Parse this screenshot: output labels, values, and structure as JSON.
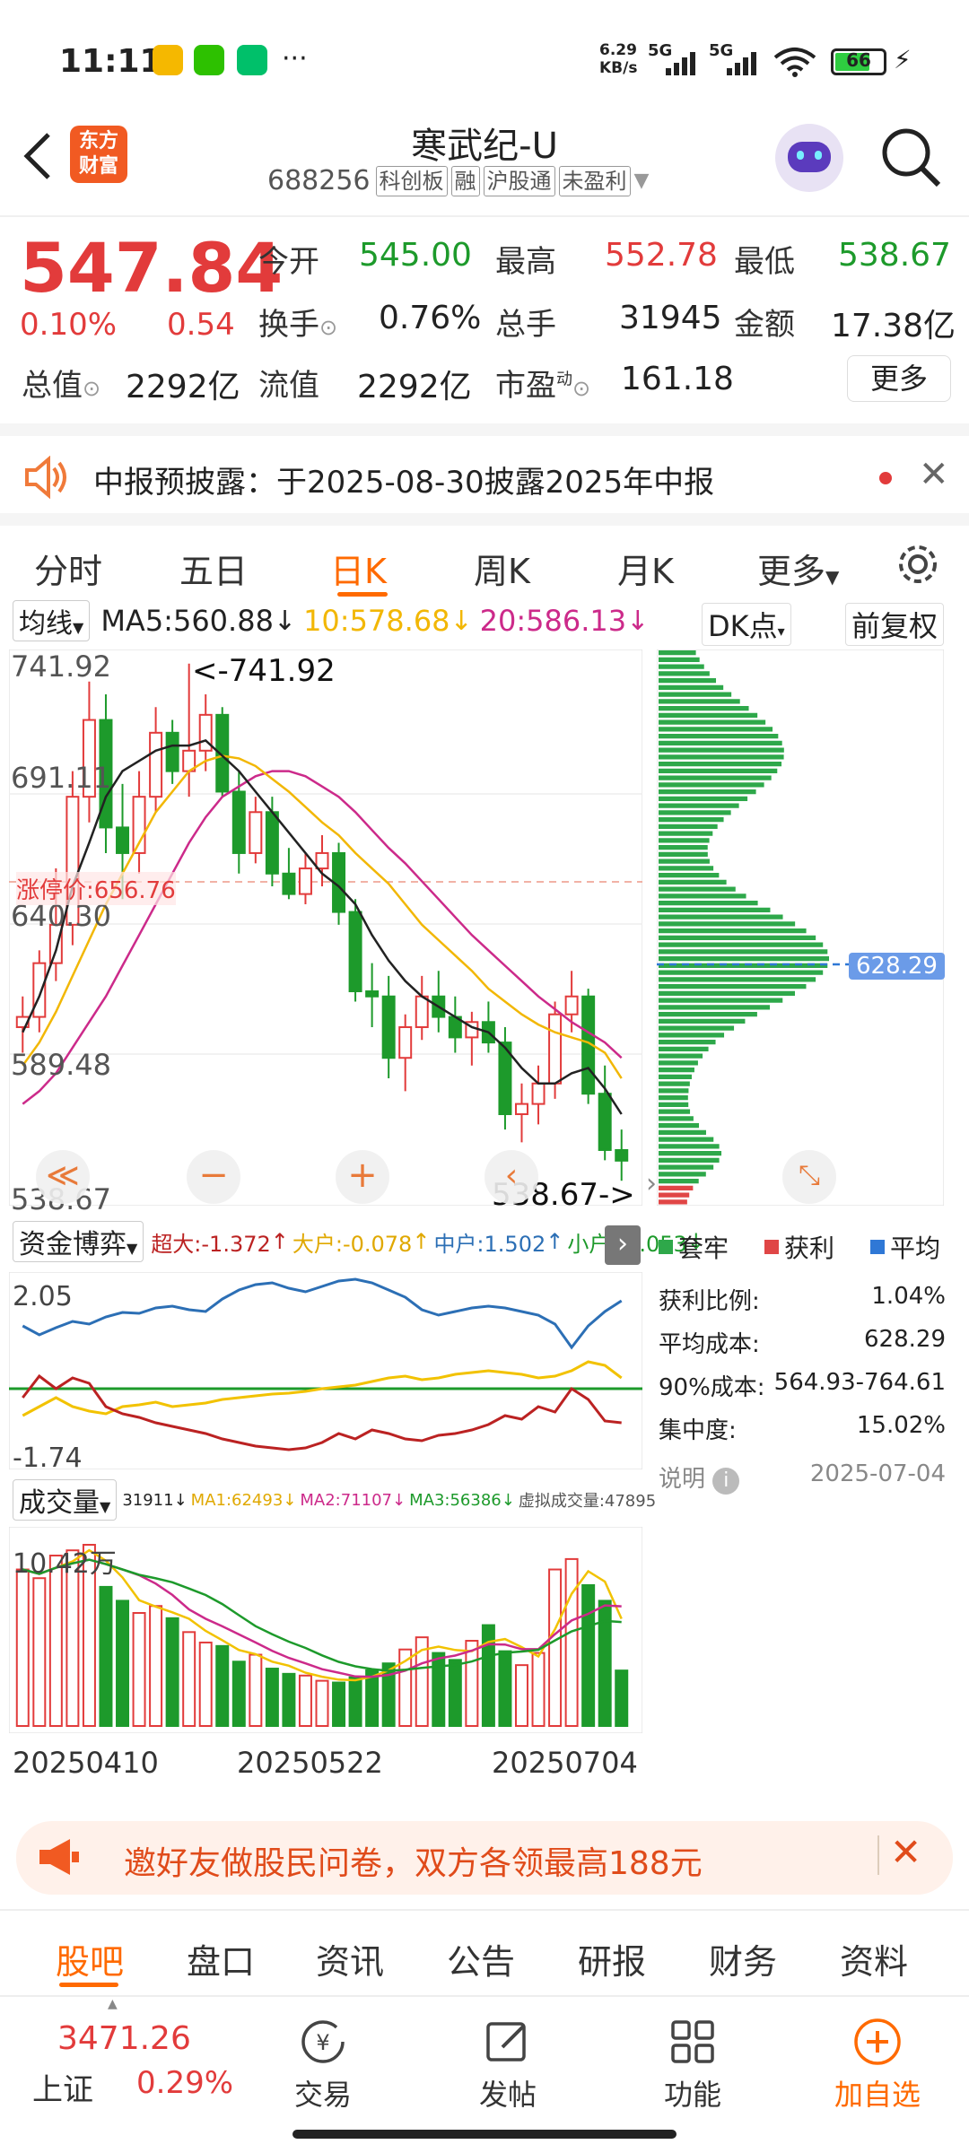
{
  "status": {
    "time": "11:11",
    "net_speed_top": "6.29",
    "net_speed_bottom": "KB/s",
    "signal1": "5G",
    "signal2": "5G",
    "battery": "66",
    "more": "···"
  },
  "header": {
    "back_icon": "chevron-left-icon",
    "logo_line1": "东方",
    "logo_line2": "财富",
    "title": "寒武纪-U",
    "code": "688256",
    "tags": [
      "科创板",
      "融",
      "沪股通",
      "未盈利"
    ],
    "search_icon": "search-icon"
  },
  "quote": {
    "price": "547.84",
    "change_pct": "0.10%",
    "change": "0.54",
    "open_label": "今开",
    "open": "545.00",
    "high_label": "最高",
    "high": "552.78",
    "low_label": "最低",
    "low": "538.67",
    "turnover_label": "换手",
    "turnover": "0.76%",
    "volume_label": "总手",
    "volume": "31945",
    "amount_label": "金额",
    "amount": "17.38亿",
    "mktcap_label": "总值",
    "mktcap": "2292亿",
    "float_label": "流值",
    "float_cap": "2292亿",
    "pe_label": "市盈",
    "pe_sup": "动",
    "pe": "161.18",
    "more_button": "更多"
  },
  "notice": {
    "text": "中报预披露：于2025-08-30披露2025年中报",
    "close_icon": "close-icon"
  },
  "chart_tabs": [
    "分时",
    "五日",
    "日K",
    "周K",
    "月K",
    "更多"
  ],
  "chart_tabs_active": 2,
  "ma_bar": {
    "selector": "均线",
    "ma5": "MA5:560.88",
    "ma10": "10:578.68",
    "ma20": "20:586.13",
    "dk_button": "DK点",
    "adjust_button": "前复权"
  },
  "kline": {
    "y_labels": [
      "741.92",
      "691.11",
      "640.30",
      "589.48",
      "538.67"
    ],
    "max_marker": "<-741.92",
    "min_marker": "538.67->",
    "limit_label": "涨停价:656.76",
    "cost_marker": "628.29"
  },
  "fund_bar": {
    "selector": "资金博弈",
    "chaoda": "超大:-1.372",
    "dahu": "大户:-0.078",
    "zhonghu": "中户:1.502",
    "xiaohu": "小户:-0.053",
    "y_top": "2.05",
    "y_bottom": "-1.74"
  },
  "chip_legend": [
    "套牢",
    "获利",
    "平均"
  ],
  "chip_stats": [
    {
      "label": "获利比例:",
      "value": "1.04%"
    },
    {
      "label": "平均成本:",
      "value": "628.29"
    },
    {
      "label": "90%成本:",
      "value": "564.93-764.61"
    },
    {
      "label": "集中度:",
      "value": "15.02%"
    }
  ],
  "chip_note": {
    "label": "说明",
    "date": "2025-07-04"
  },
  "volume_bar": {
    "selector": "成交量",
    "vol": "31911",
    "ma1": "MA1:62493",
    "ma2": "MA2:71107",
    "ma3": "MA3:56386",
    "virtual": "虚拟成交量:47895",
    "y_top": "10.42万"
  },
  "dates": [
    "20250410",
    "20250522",
    "20250704"
  ],
  "banner": {
    "text": "邀好友做股民问卷，双方各领最高188元"
  },
  "bottom_tabs": [
    "股吧",
    "盘口",
    "资讯",
    "公告",
    "研报",
    "财务",
    "资料"
  ],
  "nav": {
    "index_value": "3471.26",
    "index_name": "上证",
    "index_change": "0.29%",
    "items": [
      "交易",
      "发帖",
      "功能",
      "加自选"
    ]
  },
  "colors": {
    "up": "#e23b3b",
    "down": "#1d9a2b",
    "accent": "#ff6a00",
    "ma5": "#222222",
    "ma10": "#f2b705",
    "ma20": "#cc2a8a"
  },
  "chart_data": {
    "type": "candlestick",
    "ylim": [
      538.67,
      741.92
    ],
    "candles": [
      [
        600,
        612,
        590,
        604
      ],
      [
        604,
        630,
        598,
        625
      ],
      [
        625,
        662,
        618,
        640
      ],
      [
        640,
        700,
        632,
        690
      ],
      [
        690,
        735,
        680,
        720
      ],
      [
        720,
        730,
        668,
        678
      ],
      [
        678,
        695,
        650,
        668
      ],
      [
        668,
        700,
        660,
        690
      ],
      [
        690,
        725,
        684,
        715
      ],
      [
        715,
        720,
        695,
        700
      ],
      [
        700,
        742,
        690,
        708
      ],
      [
        708,
        730,
        700,
        722
      ],
      [
        722,
        725,
        690,
        692
      ],
      [
        692,
        700,
        660,
        668
      ],
      [
        668,
        690,
        664,
        684
      ],
      [
        684,
        690,
        655,
        660
      ],
      [
        660,
        670,
        650,
        652
      ],
      [
        652,
        668,
        648,
        662
      ],
      [
        662,
        675,
        655,
        668
      ],
      [
        668,
        672,
        640,
        645
      ],
      [
        645,
        650,
        610,
        614
      ],
      [
        614,
        625,
        600,
        612
      ],
      [
        612,
        620,
        580,
        588
      ],
      [
        588,
        605,
        575,
        600
      ],
      [
        600,
        620,
        595,
        612
      ],
      [
        612,
        622,
        598,
        604
      ],
      [
        604,
        612,
        590,
        596
      ],
      [
        596,
        606,
        585,
        602
      ],
      [
        602,
        610,
        590,
        594
      ],
      [
        594,
        600,
        560,
        566
      ],
      [
        566,
        578,
        555,
        570
      ],
      [
        570,
        585,
        562,
        578
      ],
      [
        578,
        610,
        572,
        605
      ],
      [
        605,
        622,
        598,
        612
      ],
      [
        612,
        615,
        570,
        574
      ],
      [
        574,
        585,
        548,
        552
      ],
      [
        552,
        560,
        540,
        547.84
      ]
    ],
    "ma5": [
      598,
      612,
      630,
      655,
      672,
      690,
      700,
      704,
      708,
      710,
      710,
      712,
      706,
      700,
      692,
      684,
      676,
      668,
      660,
      655,
      648,
      636,
      626,
      618,
      612,
      608,
      604,
      600,
      598,
      592,
      584,
      578,
      578,
      582,
      584,
      576,
      566
    ],
    "ma10": [
      585,
      594,
      606,
      620,
      634,
      648,
      660,
      672,
      684,
      692,
      700,
      704,
      706,
      705,
      702,
      697,
      692,
      686,
      680,
      675,
      668,
      662,
      656,
      648,
      640,
      634,
      628,
      622,
      615,
      610,
      605,
      601,
      598,
      596,
      594,
      590,
      580
    ],
    "ma20": [
      570,
      575,
      582,
      592,
      602,
      612,
      624,
      636,
      648,
      660,
      672,
      682,
      690,
      694,
      698,
      700,
      700,
      698,
      694,
      690,
      684,
      677,
      670,
      664,
      657,
      650,
      643,
      636,
      630,
      624,
      618,
      612,
      607,
      602,
      598,
      594,
      588
    ],
    "volume": [
      9.0,
      8.5,
      9.8,
      10.1,
      10.42,
      8.0,
      7.2,
      6.5,
      6.9,
      6.2,
      5.4,
      4.8,
      4.6,
      3.7,
      4.1,
      3.3,
      3.0,
      2.9,
      2.6,
      2.5,
      2.8,
      3.2,
      3.6,
      4.4,
      5.1,
      4.2,
      3.8,
      4.9,
      5.8,
      4.3,
      3.5,
      4.2,
      9.0,
      9.6,
      8.1,
      7.2,
      3.19
    ],
    "x_labels": [
      "20250410",
      "20250522",
      "20250704"
    ]
  }
}
